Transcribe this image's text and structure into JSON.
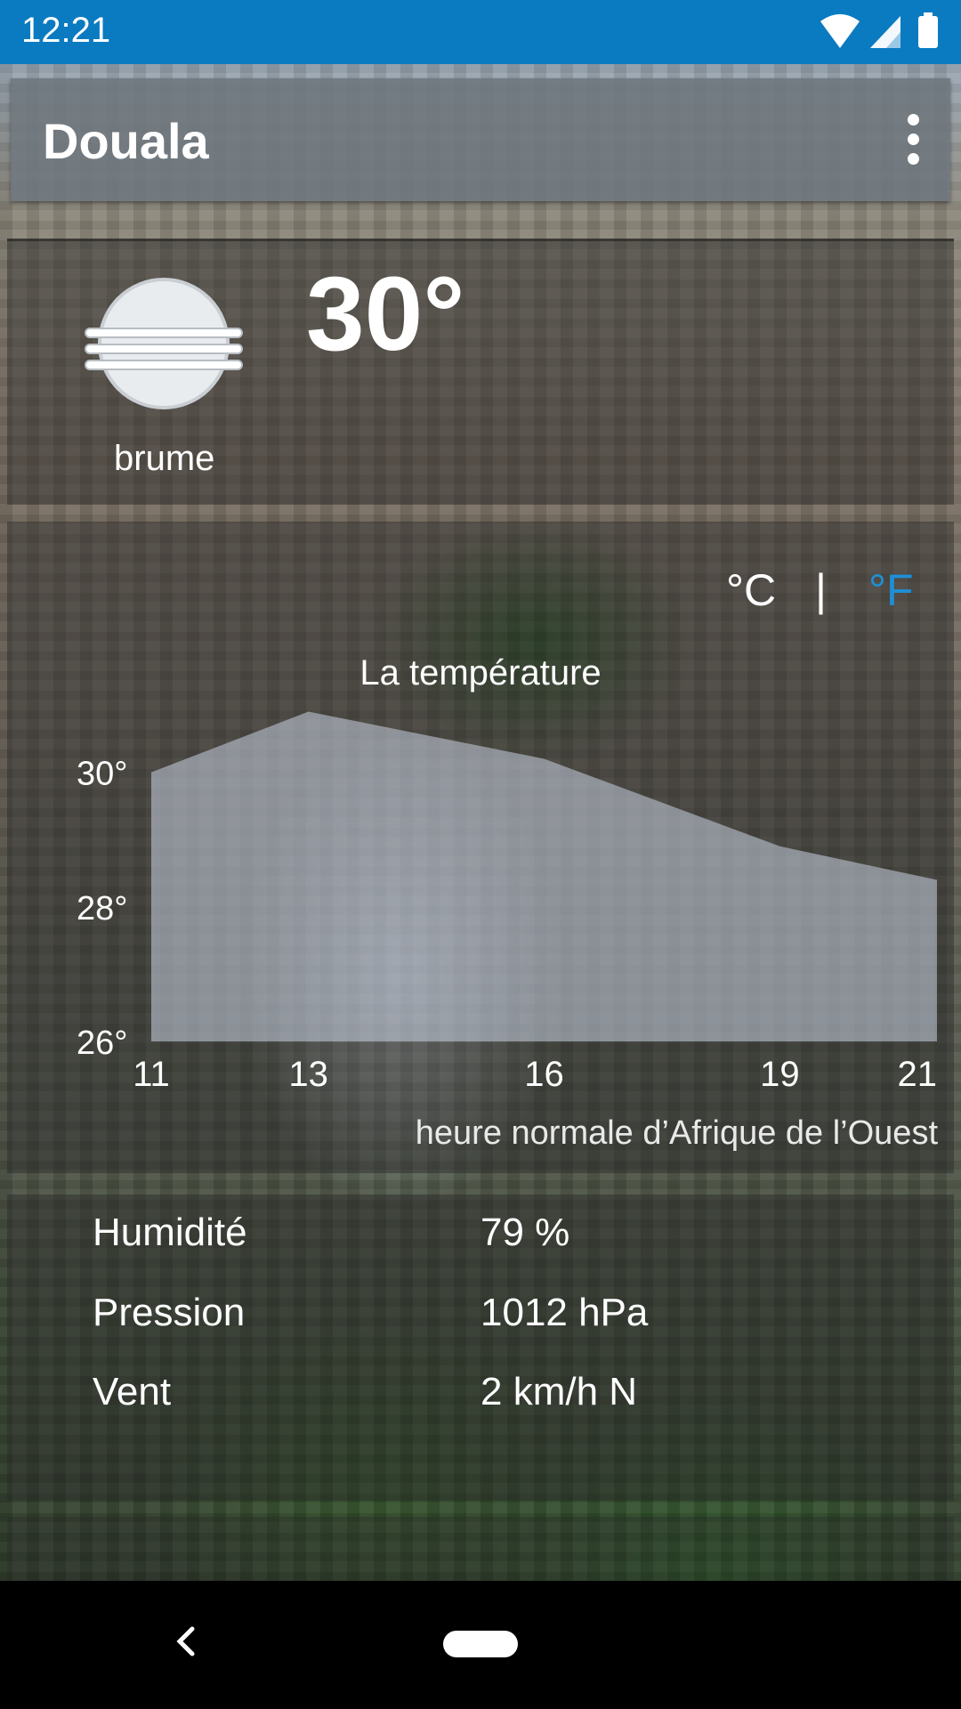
{
  "status_bar": {
    "time": "12:21",
    "icons": [
      "wifi-icon",
      "signal-icon",
      "battery-icon"
    ]
  },
  "app_bar": {
    "title": "Douala",
    "menu_icon": "more-vert-icon"
  },
  "current": {
    "condition_icon": "mist-icon",
    "condition": "brume",
    "temperature": "30°"
  },
  "units": {
    "celsius": "°C",
    "separator": "|",
    "fahrenheit": "°F",
    "selected": "fahrenheit",
    "accent": "#1e8fd6"
  },
  "chart_data": {
    "type": "area",
    "title": "La température",
    "x": [
      11,
      13,
      16,
      19,
      21
    ],
    "x_tick_labels": [
      "11",
      "13",
      "16",
      "19",
      "21"
    ],
    "series": [
      {
        "values": [
          30,
          30.9,
          30.2,
          28.9,
          28.4
        ]
      }
    ],
    "y_ticks": [
      "30°",
      "28°",
      "26°"
    ],
    "ylim": [
      26,
      31
    ],
    "xlabel": "heure normale d’Afrique de l’Ouest"
  },
  "details": {
    "rows": [
      {
        "label": "Humidité",
        "value": "79 %"
      },
      {
        "label": "Pression",
        "value": "1012 hPa"
      },
      {
        "label": "Vent",
        "value": "2 km/h N"
      }
    ]
  },
  "nav": {
    "back_icon": "back-icon",
    "home_icon": "home-pill-icon"
  }
}
